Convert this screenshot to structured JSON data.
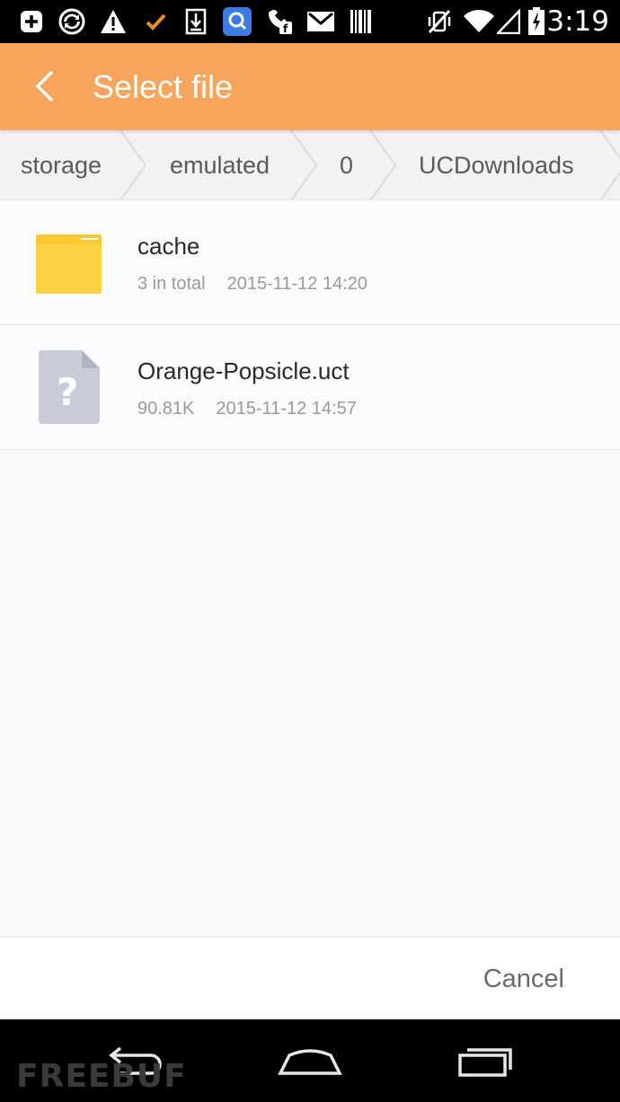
{
  "status_bar": {
    "time": "3:19",
    "icons": [
      "add-box-icon",
      "sync-icon",
      "warning-icon",
      "check-icon",
      "download-icon",
      "search-app-icon",
      "hangouts-icon",
      "gmail-icon",
      "barcode-icon",
      "vibrate-off-icon",
      "wifi-icon",
      "signal-icon",
      "battery-icon"
    ]
  },
  "header": {
    "title": "Select file",
    "background": "#f7a55c"
  },
  "breadcrumb": [
    "storage",
    "emulated",
    "0",
    "UCDownloads"
  ],
  "files": [
    {
      "name": "cache",
      "info": "3 in total",
      "date": "2015-11-12 14:20",
      "icon": "folder-icon"
    },
    {
      "name": "Orange-Popsicle.uct",
      "info": "90.81K",
      "date": "2015-11-12 14:57",
      "icon": "unknown-file-icon"
    }
  ],
  "footer": {
    "cancel_label": "Cancel"
  },
  "watermark": "FREEBUF"
}
